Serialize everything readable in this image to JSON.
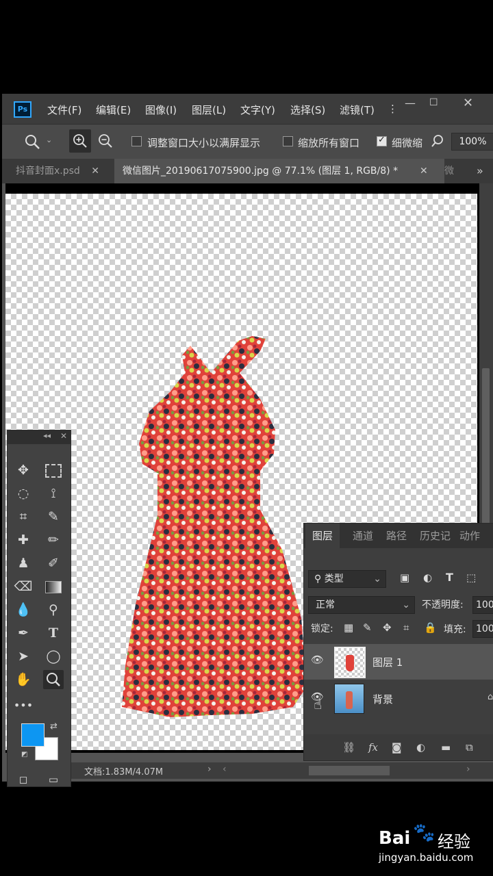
{
  "menubar": {
    "logo": "Ps",
    "items": [
      "文件(F)",
      "编辑(E)",
      "图像(I)",
      "图层(L)",
      "文字(Y)",
      "选择(S)",
      "滤镜(T)",
      "⋮"
    ]
  },
  "optionsbar": {
    "resize_windows_label": "调整窗口大小以满屏显示",
    "zoom_all_label": "缩放所有窗口",
    "scrubby_label": "细微缩",
    "zoom_value": "100%"
  },
  "tabs": {
    "tab1": "抖音封面x.psd",
    "tab2": "微信图片_20190617075900.jpg @ 77.1% (图层 1, RGB/8) *",
    "tab3": "微",
    "more": "»"
  },
  "statusbar": {
    "doc_info": "文档:1.83M/4.07M"
  },
  "layers_panel": {
    "tabs": [
      "图层",
      "通道",
      "路径",
      "历史记",
      "动作"
    ],
    "filter_label": "类型",
    "blend_mode": "正常",
    "opacity_label": "不透明度:",
    "opacity_value": "100",
    "lock_label": "锁定:",
    "fill_label": "填充:",
    "fill_value": "100",
    "layers": [
      {
        "name": "图层 1"
      },
      {
        "name": "背景"
      }
    ]
  },
  "watermark": {
    "brand": "Bai",
    "brand2": "经验",
    "url": "jingyan.baidu.com"
  },
  "colors": {
    "foreground": "#0d96f2",
    "background": "#ffffff"
  }
}
